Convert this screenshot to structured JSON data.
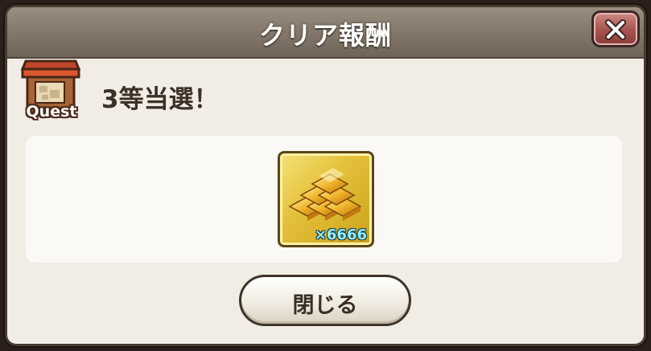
{
  "dialog": {
    "title": "クリア報酬",
    "close_icon": "close-x-icon"
  },
  "quest": {
    "icon": "quest-shop-icon",
    "label": "Quest"
  },
  "result": {
    "text": "3等当選！"
  },
  "reward": {
    "item_icon": "gold-bars-icon",
    "quantity": "×6666"
  },
  "actions": {
    "close_label": "閉じる"
  },
  "colors": {
    "titlebar": "#867a6d",
    "close_button": "#a85651",
    "item_frame": "#e5c23c",
    "quantity_text": "#8ff0ff"
  }
}
